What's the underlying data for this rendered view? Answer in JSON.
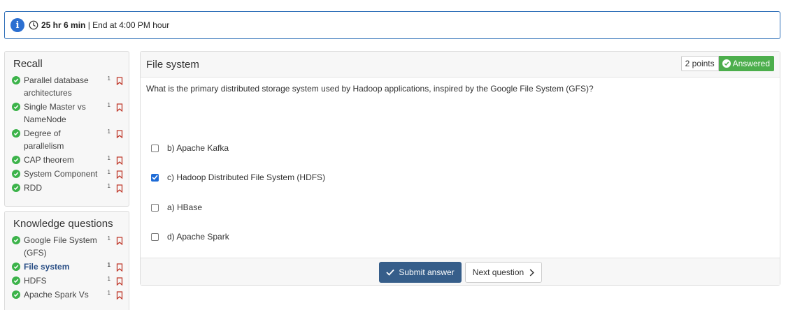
{
  "timer": {
    "duration": "25 hr 6 min",
    "separator": "|",
    "end_text": "End at 4:00 PM hour"
  },
  "recall": {
    "title": "Recall",
    "items": [
      {
        "label_line1": "Parallel database",
        "label_line2": "architectures",
        "count": "1"
      },
      {
        "label_line1": "Single Master vs",
        "label_line2": "NameNode",
        "count": "1"
      },
      {
        "label_line1": "Degree of",
        "label_line2": "parallelism",
        "count": "1"
      },
      {
        "label_line1": "CAP theorem",
        "count": "1"
      },
      {
        "label_line1": "System Component",
        "count": "1"
      },
      {
        "label_line1": "RDD",
        "count": "1"
      }
    ]
  },
  "knowledge": {
    "title": "Knowledge questions",
    "items": [
      {
        "label_line1": "Google File System",
        "label_line2": "(GFS)",
        "count": "1"
      },
      {
        "label_line1": "File system",
        "count": "1",
        "active": true
      },
      {
        "label_line1": "HDFS",
        "count": "1"
      },
      {
        "label_line1": "Apache Spark Vs",
        "count": "1"
      }
    ]
  },
  "question": {
    "title": "File system",
    "points": "2 points",
    "status": "Answered",
    "text": "What is the primary distributed storage system used by Hadoop applications, inspired by the Google File System (GFS)?",
    "options": [
      {
        "label": "b) Apache Kafka",
        "checked": false
      },
      {
        "label": "c) Hadoop Distributed File System (HDFS)",
        "checked": true
      },
      {
        "label": "a) HBase",
        "checked": false
      },
      {
        "label": "d) Apache Spark",
        "checked": false
      }
    ],
    "submit_label": "Submit answer",
    "next_label": "Next question"
  },
  "colors": {
    "accent": "#365e8a",
    "success": "#4cae4c",
    "check": "#3cb34a",
    "info": "#2b6fd1",
    "bookmark": "#c0392b"
  }
}
